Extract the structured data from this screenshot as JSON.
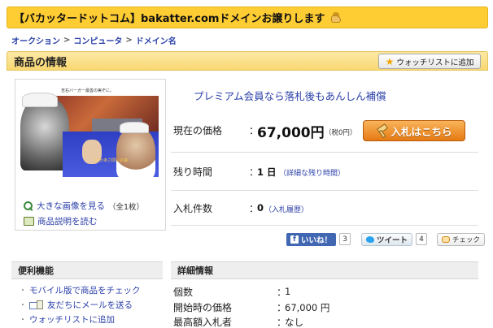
{
  "header": {
    "title": "【バカッタードットコム】bakatter.comドメインお譲りします",
    "icon": "hand-raise-icon"
  },
  "breadcrumb": {
    "items": [
      "オークション",
      "コンピュータ",
      "ドメイン名"
    ],
    "separator": ">"
  },
  "section": {
    "title": "商品の情報",
    "watchlist_button": "ウォッチリストに追加"
  },
  "image_panel": {
    "photo_caption": "",
    "shop_sign": "吉右バーガー最善の実ぞに。",
    "overlay_text": "ばかあさ問いお会",
    "view_large_label": "大きな画像を見る",
    "view_large_count": "（全1枚）",
    "read_description_label": "商品説明を読む"
  },
  "listing": {
    "promo": "プレミアム会員なら落札後もあんしん補償",
    "price_label": "現在の価格",
    "price_value": "67,000円",
    "tax_note": "（税0円）",
    "bid_button": "入札はこちら",
    "time_left_label": "残り時間",
    "time_left_value": "1 日",
    "time_detail_link": "（詳細な残り時間）",
    "bid_count_label": "入札件数",
    "bid_count_value": "0",
    "bid_history_link": "（入札履歴）"
  },
  "social": {
    "facebook_label": "いいね！",
    "facebook_count": "3",
    "twitter_label": "ツイート",
    "twitter_count": "4",
    "check_label": "チェック"
  },
  "functions": {
    "title": "便利機能",
    "items": [
      "モバイル版で商品をチェック",
      "友だちにメールを送る",
      "ウォッチリストに追加"
    ]
  },
  "details": {
    "title": "詳細情報",
    "rows": [
      {
        "label": "個数",
        "value": "1"
      },
      {
        "label": "開始時の価格",
        "value": "67,000 円"
      },
      {
        "label": "最高額入札者",
        "value": "なし"
      }
    ]
  },
  "colors": {
    "title_bar": "#fecc33",
    "link": "#2a3fa8",
    "bid_button": "#e57a13",
    "facebook": "#4267b2"
  }
}
